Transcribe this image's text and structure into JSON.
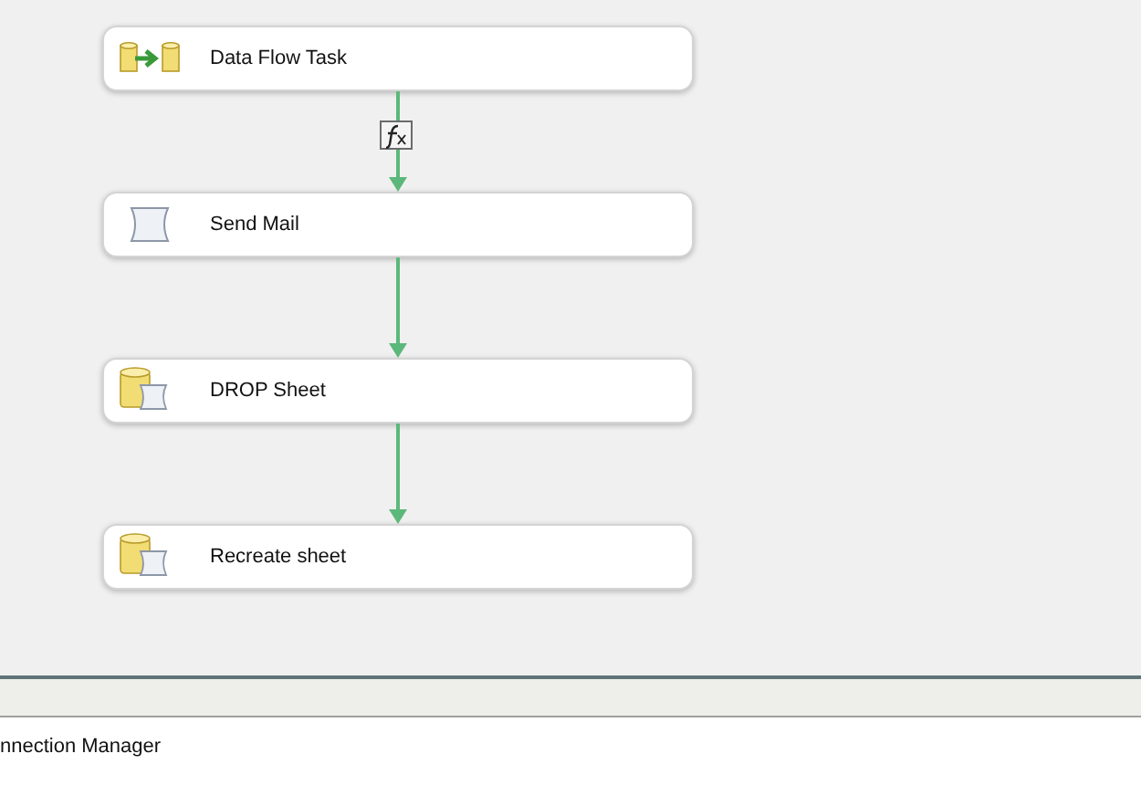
{
  "nodes": [
    {
      "label": "Data Flow Task",
      "kind": "dataflow"
    },
    {
      "label": "Send Mail",
      "kind": "sendmail"
    },
    {
      "label": "DROP Sheet",
      "kind": "sql"
    },
    {
      "label": "Recreate sheet",
      "kind": "sql"
    }
  ],
  "connectors": [
    {
      "expression": true
    },
    {
      "expression": false
    },
    {
      "expression": false
    }
  ],
  "bottom_panel": {
    "title": "nnection Manager"
  }
}
